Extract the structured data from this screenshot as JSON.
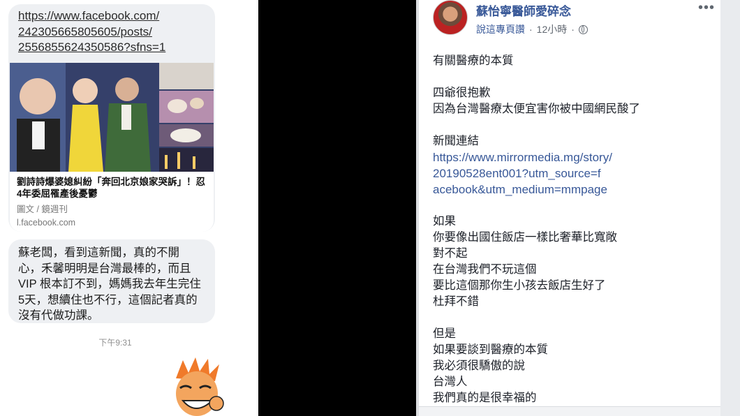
{
  "chat": {
    "link_url_lines": [
      "https://www.facebook.com/",
      "242305665805605/posts/",
      "2556855624350586?sfns=1"
    ],
    "preview": {
      "title": "劉詩詩爆婆媳糾紛「奔回北京娘家哭訴」！忍4年委屈罹產後憂鬱",
      "source": "圖文 / 鏡週刊",
      "domain": "l.facebook.com"
    },
    "message": "蘇老闆，看到這新聞，真的不開心，禾馨明明是台灣最棒的，而且VIP 根本訂不到，媽媽我去年生完住5天，想續住也不行，這個記者真的沒有代做功課。",
    "message_lines": [
      "蘇老闆，看到這新聞，真的不開",
      "心，禾馨明明是台灣最棒的，而且",
      "VIP 根本訂不到，媽媽我去年生完住",
      "5天，想續住也不行，這個記者真的",
      "沒有代做功課。"
    ],
    "time": "下午9:31"
  },
  "post": {
    "page_name": "蘇怡寧醫師愛碎念",
    "via": "說這專頁讚",
    "time": "12小時",
    "sep": "·",
    "more": "•••",
    "body": [
      {
        "t": "有關醫療的本質"
      },
      {
        "t": ""
      },
      {
        "t": "四爺很抱歉"
      },
      {
        "t": "因為台灣醫療太便宜害你被中國網民酸了"
      },
      {
        "t": ""
      },
      {
        "t": "新聞連結"
      },
      {
        "t": "https://www.mirrormedia.mg/story/",
        "link": true
      },
      {
        "t": "20190528ent001?utm_source=f",
        "link": true
      },
      {
        "t": "acebook&utm_medium=mmpage",
        "link": true
      },
      {
        "t": ""
      },
      {
        "t": "如果"
      },
      {
        "t": "你要像出國住飯店一樣比奢華比寬敞"
      },
      {
        "t": "對不起"
      },
      {
        "t": "在台灣我們不玩這個"
      },
      {
        "t": "要比這個那你生小孩去飯店生好了"
      },
      {
        "t": "杜拜不錯"
      },
      {
        "t": ""
      },
      {
        "t": "但是"
      },
      {
        "t": "如果要談到醫療的本質"
      },
      {
        "t": "我必須很驕傲的說"
      },
      {
        "t": "台灣人"
      },
      {
        "t": "我們真的是很幸福的"
      }
    ]
  },
  "colors": {
    "fb_blue": "#385898",
    "bubble_gray": "#eef0f3"
  }
}
